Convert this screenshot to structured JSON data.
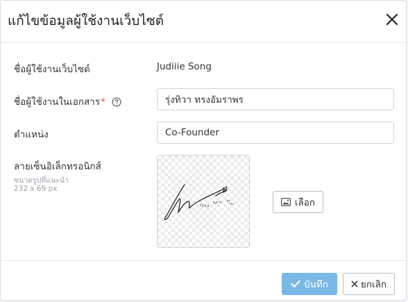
{
  "modal": {
    "title": "แก้ไขข้อมูลผู้ใช้งานเว็บไซต์",
    "close_icon": "close-icon"
  },
  "form": {
    "website_user_name": {
      "label": "ชื่อผู้ใช้งานเว็บไซต์",
      "value": "Judiiie Song"
    },
    "document_user_name": {
      "label": "ชื่อผู้ใช้งานในเอกสาร",
      "required_mark": "*",
      "help_icon": "help-circle-icon",
      "value": "รุ่งทิวา ทรงอัมราพร"
    },
    "position": {
      "label": "ตำแหน่ง",
      "value": "Co-Founder"
    },
    "e_signature": {
      "label": "ลายเซ็นอิเล็กทรอนิกส์",
      "size_hint": "ขนาดรูปที่แนะนำ",
      "size_dims": "232 x 69 px",
      "image_icon": "image-icon",
      "choose_label": "เลือก"
    }
  },
  "footer": {
    "save_label": "บันทึก",
    "save_icon": "check-icon",
    "cancel_label": "ยกเลิก",
    "cancel_icon": "x-icon"
  },
  "colors": {
    "save_button": "#7ab8e6",
    "required_mark": "#e04b4b",
    "hint_text": "#9aa0a6"
  }
}
